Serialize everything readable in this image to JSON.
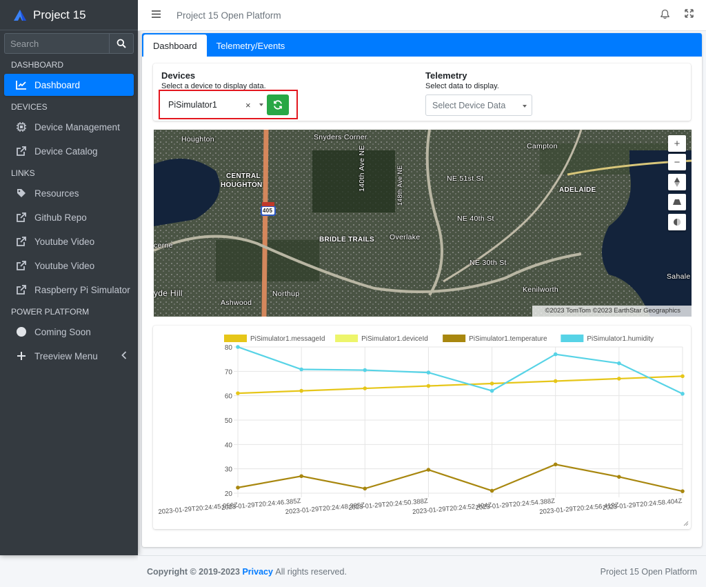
{
  "app": {
    "name": "Project 15"
  },
  "sidebar": {
    "search_placeholder": "Search",
    "sections": [
      {
        "header": "DASHBOARD"
      },
      {
        "header": "DEVICES"
      },
      {
        "header": "LINKS"
      },
      {
        "header": "POWER PLATFORM"
      }
    ],
    "items": [
      {
        "label": "Dashboard",
        "icon": "chart-line-icon"
      },
      {
        "label": "Device Management",
        "icon": "chip-icon"
      },
      {
        "label": "Device Catalog",
        "icon": "external-link-icon"
      },
      {
        "label": "Resources",
        "icon": "tag-icon"
      },
      {
        "label": "Github Repo",
        "icon": "external-link-icon"
      },
      {
        "label": "Youtube Video",
        "icon": "external-link-icon"
      },
      {
        "label": "Youtube Video",
        "icon": "external-link-icon"
      },
      {
        "label": "Raspberry Pi Simulator",
        "icon": "external-link-icon"
      },
      {
        "label": "Coming Soon",
        "icon": "circle-icon"
      },
      {
        "label": "Treeview Menu",
        "icon": "plus-icon"
      }
    ]
  },
  "topbar": {
    "title": "Project 15 Open Platform"
  },
  "tabs": [
    {
      "label": "Dashboard"
    },
    {
      "label": "Telemetry/Events"
    }
  ],
  "devices": {
    "label": "Devices",
    "sub": "Select a device to display data.",
    "selected": "PiSimulator1",
    "clear": "×"
  },
  "telemetry": {
    "label": "Telemetry",
    "sub": "Select data to display.",
    "placeholder": "Select Device Data"
  },
  "map": {
    "attribution": "©2023 TomTom ©2023 EarthStar Geographics",
    "labels": [
      "Houghton",
      "Snyders Corner",
      "Campton",
      "CENTRAL",
      "HOUGHTON",
      "ADELAIDE",
      "BRIDLE TRAILS",
      "Overlake",
      "NE 51st St",
      "NE 40th St",
      "NE 30th St",
      "Kenilworth",
      "Sahale",
      "Northup",
      "Ashwood",
      "yde Hill",
      "cerne",
      "140th Ave NE",
      "148th Ave NE",
      "405"
    ]
  },
  "colors": {
    "accent": "#007bff",
    "sidebar": "#343a40",
    "refresh": "#28a745",
    "highlight": "#e3161e"
  },
  "chart_data": {
    "type": "line",
    "categories": [
      "2023-01-29T20:24:45.056Z",
      "2023-01-29T20:24:46.385Z",
      "2023-01-29T20:24:48.385Z",
      "2023-01-29T20:24:50.388Z",
      "2023-01-29T20:24:52.404Z",
      "2023-01-29T20:24:54.388Z",
      "2023-01-29T20:24:56.419Z",
      "2023-01-29T20:24:58.404Z"
    ],
    "ylim": [
      20,
      80
    ],
    "yticks": [
      20,
      30,
      40,
      50,
      60,
      70,
      80
    ],
    "grid": true,
    "legend_position": "top",
    "series": [
      {
        "name": "PiSimulator1.messageId",
        "color": "#e6c619",
        "values": [
          61,
          62,
          63,
          64,
          65,
          66,
          67,
          68
        ]
      },
      {
        "name": "PiSimulator1.deviceId",
        "color": "#edf56b",
        "values": []
      },
      {
        "name": "PiSimulator1.temperature",
        "color": "#a8870f",
        "values": [
          22.3,
          27,
          21.9,
          29.6,
          21,
          31.8,
          26.7,
          20.8
        ]
      },
      {
        "name": "PiSimulator1.humidity",
        "color": "#57d3e6",
        "values": [
          80,
          70.8,
          70.5,
          69.5,
          62,
          77,
          73.3,
          60.8
        ]
      }
    ]
  },
  "footer": {
    "copyright": "Copyright © 2019-2023",
    "privacy": "Privacy",
    "rights": "All rights reserved.",
    "platform": "Project 15 Open Platform"
  }
}
